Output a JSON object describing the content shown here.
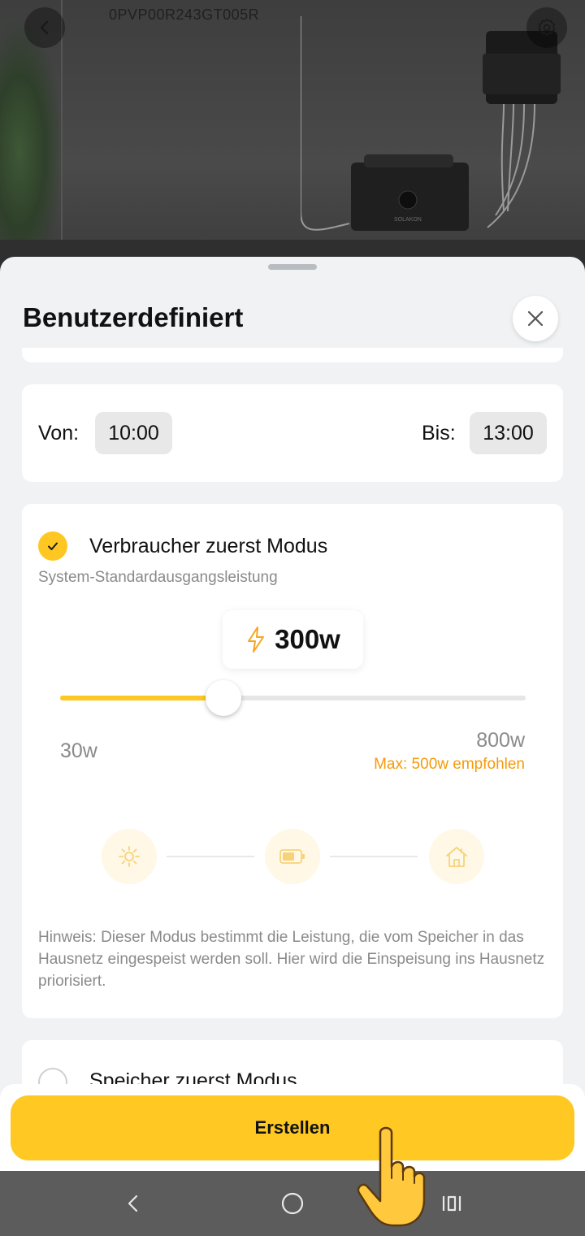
{
  "header": {
    "device_serial": "0PVP00R243GT005R",
    "back_icon": "back-arrow-icon",
    "settings_icon": "gear-icon"
  },
  "sheet": {
    "title": "Benutzerdefiniert",
    "close_icon": "close-icon"
  },
  "time_range": {
    "from_label": "Von:",
    "from_value": "10:00",
    "to_label": "Bis:",
    "to_value": "13:00"
  },
  "consumer_mode": {
    "selected": true,
    "title": "Verbraucher zuerst Modus",
    "subtitle": "System-Standardausgangsleistung",
    "power_value": "300w",
    "slider_fraction": 0.35,
    "min_label": "30w",
    "max_label": "800w",
    "recommendation": "Max: 500w empfohlen",
    "flow_icons": [
      "sun-icon",
      "battery-icon",
      "house-icon"
    ],
    "hint": "Hinweis: Dieser Modus bestimmt die Leistung, die vom Speicher in das Hausnetz eingespeist werden soll. Hier wird die Einspeisung ins Hausnetz priorisiert."
  },
  "storage_mode": {
    "selected": false,
    "title": "Speicher zuerst Modus"
  },
  "actions": {
    "create_label": "Erstellen"
  },
  "colors": {
    "accent": "#ffc822",
    "recommendation": "#f59a0a",
    "sheet_background": "#f0f2f4"
  },
  "navbar": {
    "icons": [
      "nav-back-icon",
      "nav-home-icon",
      "nav-recents-icon"
    ]
  }
}
